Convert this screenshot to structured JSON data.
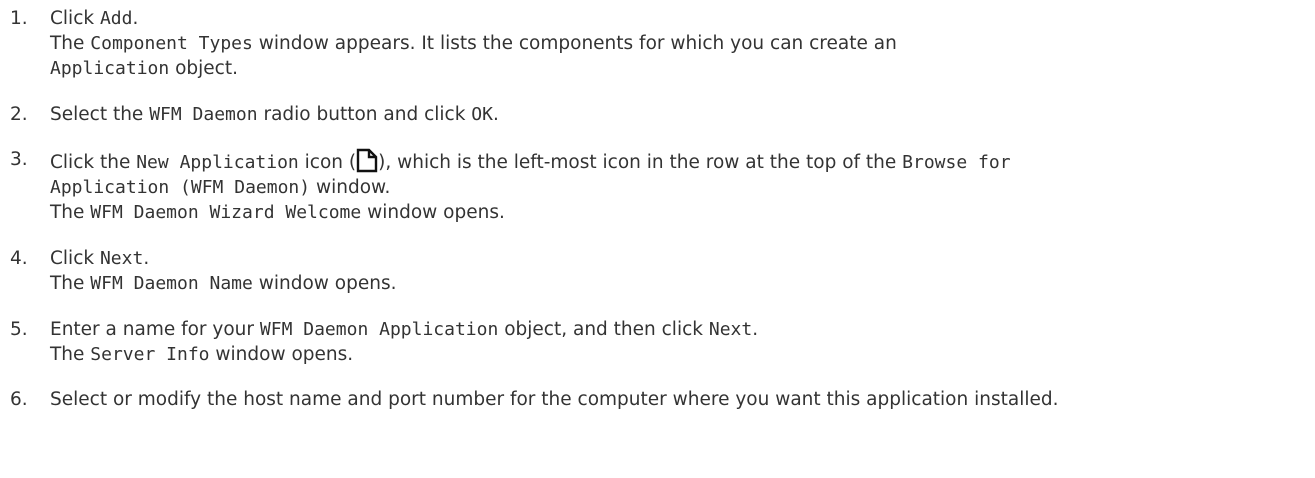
{
  "steps": [
    {
      "number": "1.",
      "line1": {
        "t0": "Click ",
        "t1": "Add",
        "t2": "."
      },
      "line2": {
        "t0": "The ",
        "t1": "Component Types",
        "t2": " window appears. It lists the components for which you can create an"
      },
      "line3": {
        "t0": "Application",
        "t1": " object."
      }
    },
    {
      "number": "2.",
      "line1": {
        "t0": "Select the ",
        "t1": "WFM Daemon",
        "t2": " radio button and click ",
        "t3": "OK",
        "t4": "."
      }
    },
    {
      "number": "3.",
      "line1": {
        "t0": "Click the ",
        "t1": "New Application",
        "t2": " icon (",
        "t3": "), which is the left-most icon in the row at the top of the ",
        "t4": "Browse for"
      },
      "line2": {
        "t0": "Application (WFM Daemon)",
        "t1": " window."
      },
      "line3": {
        "t0": "The ",
        "t1": "WFM Daemon Wizard Welcome",
        "t2": " window opens."
      }
    },
    {
      "number": "4.",
      "line1": {
        "t0": "Click ",
        "t1": "Next",
        "t2": "."
      },
      "line2": {
        "t0": "The ",
        "t1": "WFM Daemon Name",
        "t2": " window opens."
      }
    },
    {
      "number": "5.",
      "line1": {
        "t0": "Enter a name for your ",
        "t1": "WFM Daemon Application",
        "t2": " object, and then click ",
        "t3": "Next",
        "t4": "."
      },
      "line2": {
        "t0": "The ",
        "t1": "Server Info",
        "t2": " window opens."
      }
    },
    {
      "number": "6.",
      "line1": {
        "t0": "Select or modify the host name and port number for the computer where you want this application installed."
      }
    }
  ],
  "icons": {
    "new_application": "new-document-icon"
  },
  "colors": {
    "text": "#333333"
  }
}
